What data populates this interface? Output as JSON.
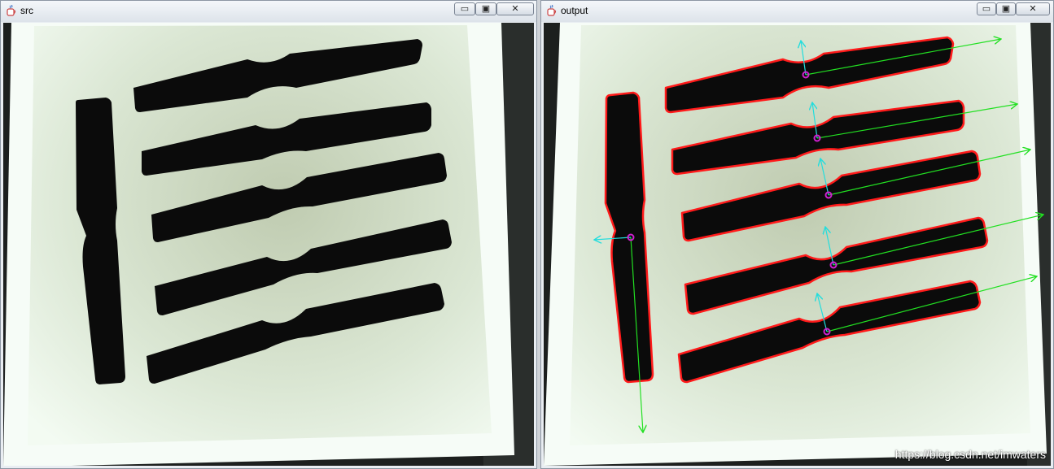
{
  "windows": {
    "src": {
      "title": "src",
      "controls": {
        "minimize": "▭",
        "maximize": "▣",
        "close": "✕"
      }
    },
    "output": {
      "title": "output",
      "controls": {
        "minimize": "▭",
        "maximize": "▣",
        "close": "✕"
      }
    }
  },
  "watermark": "https://blog.csdn.net/imwaters",
  "colors": {
    "contour": "#ff1a1a",
    "major_axis": "#22e022",
    "minor_axis": "#22dddd",
    "center": "#d020d0",
    "lightbox": "#eaf3e6",
    "part": "#0b0b0b"
  },
  "icons": {
    "app": "java-cup-icon",
    "minimize": "minimize-icon",
    "maximize": "maximize-icon",
    "close": "close-icon"
  }
}
